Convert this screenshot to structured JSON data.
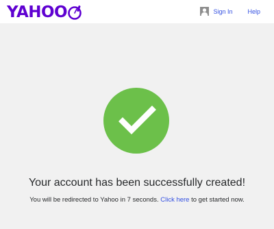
{
  "header": {
    "logo_text": "YAHOO",
    "sign_in_label": "Sign In",
    "help_label": "Help",
    "brand_color": "#5f01d1",
    "link_color": "#324fe1"
  },
  "main": {
    "status_icon": "checkmark-icon",
    "success_color": "#6cc04a",
    "headline": "Your account has been successfully created!",
    "redirect_prefix": "You will be redirected to Yahoo in 7 seconds.",
    "click_here_label": "Click here",
    "redirect_suffix": "to get started now."
  }
}
